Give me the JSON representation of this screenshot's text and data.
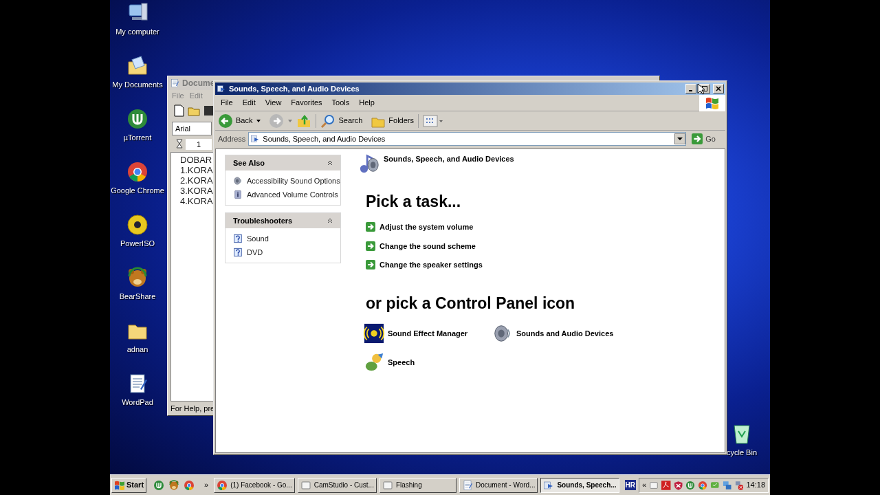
{
  "desktop_icons": [
    {
      "label": "My computer",
      "kind": "computer"
    },
    {
      "label": "My Documents",
      "kind": "documents"
    },
    {
      "label": "µTorrent",
      "kind": "torrent"
    },
    {
      "label": "Google Chrome",
      "kind": "chrome"
    },
    {
      "label": "PowerISO",
      "kind": "disc"
    },
    {
      "label": "BearShare",
      "kind": "bear"
    },
    {
      "label": "adnan",
      "kind": "folder"
    },
    {
      "label": "WordPad",
      "kind": "wordpad"
    }
  ],
  "recycle_bin": {
    "label": "cycle Bin"
  },
  "background_window": {
    "title": "Docume",
    "menu": [
      "File",
      "Edit"
    ],
    "font_field": "Arial",
    "ruler_mark": "1",
    "document_lines": [
      "DOBAR",
      "1.KORA",
      "2.KORA",
      "3.KORA",
      "4.KORA"
    ],
    "status": "For Help, pre"
  },
  "window": {
    "title": "Sounds, Speech, and Audio Devices",
    "menu": [
      "File",
      "Edit",
      "View",
      "Favorites",
      "Tools",
      "Help"
    ],
    "toolbar": {
      "back": "Back",
      "search": "Search",
      "folders": "Folders"
    },
    "address": {
      "label": "Address",
      "value": "Sounds, Speech, and Audio Devices",
      "go": "Go"
    },
    "sidebar": [
      {
        "title": "See Also",
        "expanded": true,
        "items": [
          {
            "label": "Accessibility Sound Options",
            "kind": "speaker"
          },
          {
            "label": "Advanced Volume Controls",
            "kind": "info"
          }
        ]
      },
      {
        "title": "Troubleshooters",
        "expanded": true,
        "items": [
          {
            "label": "Sound",
            "kind": "help"
          },
          {
            "label": "DVD",
            "kind": "help"
          }
        ]
      }
    ],
    "header": "Sounds, Speech, and Audio Devices",
    "task_heading": "Pick a task...",
    "tasks": [
      "Adjust the system volume",
      "Change the sound scheme",
      "Change the speaker settings"
    ],
    "icons_heading": "or pick a Control Panel icon",
    "control_panel_icons": [
      {
        "label": "Sound Effect Manager",
        "kind": "effect"
      },
      {
        "label": "Sounds and Audio Devices",
        "kind": "speaker"
      },
      {
        "label": "Speech",
        "kind": "speech"
      }
    ]
  },
  "taskbar": {
    "start": "Start",
    "quick_launch": [
      {
        "kind": "torrent"
      },
      {
        "kind": "bear"
      },
      {
        "kind": "chrome"
      }
    ],
    "more": "»",
    "buttons": [
      {
        "label": "(1) Facebook - Go...",
        "kind": "chrome",
        "selected": false
      },
      {
        "label": "CamStudio - Cust...",
        "kind": "blank",
        "selected": false
      },
      {
        "label": "Flashing",
        "kind": "blank",
        "selected": false
      },
      {
        "label": "Document - Word...",
        "kind": "wordpad",
        "selected": false
      },
      {
        "label": "Sounds, Speech...",
        "kind": "control",
        "selected": true
      }
    ],
    "language": "HR",
    "tray_expand": "«",
    "clock": "14:18"
  }
}
